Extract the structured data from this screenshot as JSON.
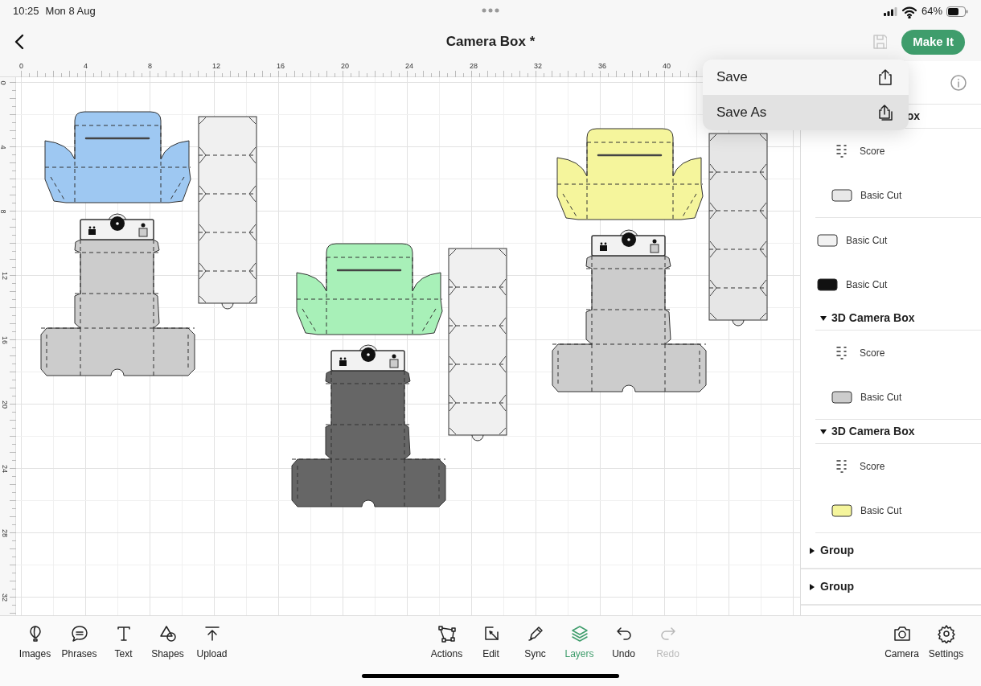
{
  "status_bar": {
    "time": "10:25",
    "date": "Mon 8 Aug",
    "battery": "64%"
  },
  "header": {
    "title": "Camera Box *",
    "action_button": "Make It"
  },
  "save_menu": [
    {
      "label": "Save",
      "selected": false
    },
    {
      "label": "Save As",
      "selected": true
    }
  ],
  "ruler": {
    "x_ticks": [
      "0",
      "4",
      "8",
      "12",
      "16",
      "20",
      "24",
      "28",
      "32",
      "36",
      "40"
    ],
    "y_ticks": [
      "0",
      "4",
      "8",
      "12",
      "16",
      "20",
      "24",
      "28",
      "32"
    ]
  },
  "canvas": {
    "pieces": [
      {
        "kind": "lid",
        "color": "#9ec8f2"
      },
      {
        "kind": "body",
        "color": "#cccccc"
      },
      {
        "kind": "strip",
        "color": "#f0f0f0"
      },
      {
        "kind": "lid",
        "color": "#a8f0b8"
      },
      {
        "kind": "body",
        "color": "#666666"
      },
      {
        "kind": "strip",
        "color": "#f0f0f0"
      },
      {
        "kind": "lid",
        "color": "#f5f59c"
      },
      {
        "kind": "body",
        "color": "#cccccc"
      },
      {
        "kind": "strip",
        "color": "#e6e6e6"
      }
    ]
  },
  "layers": [
    {
      "kind": "group",
      "title": "ox",
      "children": [
        {
          "kind": "score",
          "label": "Score"
        },
        {
          "kind": "cut",
          "label": "Basic Cut",
          "color": "#e8e8e8"
        }
      ]
    },
    {
      "kind": "cut",
      "label": "Basic Cut",
      "color": "#f2f2f2"
    },
    {
      "kind": "cut",
      "label": "Basic Cut",
      "color": "#111111"
    },
    {
      "kind": "group",
      "title": "3D Camera Box",
      "expanded": true,
      "children": [
        {
          "kind": "score",
          "label": "Score"
        },
        {
          "kind": "cut",
          "label": "Basic Cut",
          "color": "#cccccc"
        }
      ]
    },
    {
      "kind": "group",
      "title": "3D Camera Box",
      "expanded": true,
      "children": [
        {
          "kind": "score",
          "label": "Score"
        },
        {
          "kind": "cut",
          "label": "Basic Cut",
          "color": "#f5f59c"
        }
      ]
    },
    {
      "kind": "group",
      "title": "Group",
      "expanded": false
    },
    {
      "kind": "group",
      "title": "Group",
      "expanded": false
    }
  ],
  "toolbar": {
    "left": [
      {
        "label": "Images",
        "selected": false,
        "disabled": false
      },
      {
        "label": "Phrases",
        "selected": false,
        "disabled": false
      },
      {
        "label": "Text",
        "selected": false,
        "disabled": false
      },
      {
        "label": "Shapes",
        "selected": false,
        "disabled": false
      },
      {
        "label": "Upload",
        "selected": false,
        "disabled": false
      }
    ],
    "center": [
      {
        "label": "Actions",
        "selected": false,
        "disabled": false
      },
      {
        "label": "Edit",
        "selected": false,
        "disabled": false
      },
      {
        "label": "Sync",
        "selected": false,
        "disabled": false
      },
      {
        "label": "Layers",
        "selected": true,
        "disabled": false
      },
      {
        "label": "Undo",
        "selected": false,
        "disabled": false
      },
      {
        "label": "Redo",
        "selected": false,
        "disabled": true
      }
    ],
    "right": [
      {
        "label": "Camera",
        "selected": false,
        "disabled": false
      },
      {
        "label": "Settings",
        "selected": false,
        "disabled": false
      }
    ]
  }
}
